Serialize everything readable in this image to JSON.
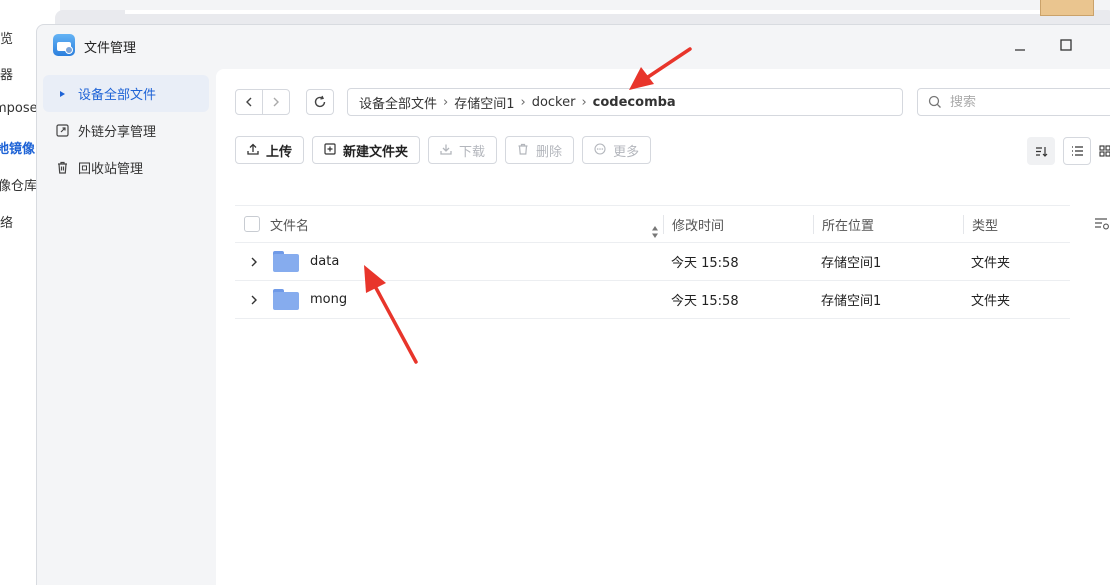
{
  "background_app": {
    "items": [
      {
        "label": "览"
      },
      {
        "label": "器"
      },
      {
        "label": "mpose"
      },
      {
        "label": "地镜像"
      },
      {
        "label": "像仓库"
      },
      {
        "label": "络"
      }
    ],
    "close_glyph": "x"
  },
  "window": {
    "title": "文件管理",
    "app_icon": "file-manager-app-icon",
    "controls": {
      "minimize": "—",
      "maximize": "☐",
      "close": "×"
    }
  },
  "sidebar": {
    "items": [
      {
        "label": "设备全部文件",
        "icon": "caret-right-icon",
        "active": true
      },
      {
        "label": "外链分享管理",
        "icon": "link-icon",
        "active": false
      },
      {
        "label": "回收站管理",
        "icon": "trash-icon",
        "active": false
      }
    ]
  },
  "breadcrumb": {
    "parts": [
      "设备全部文件",
      "存储空间1",
      "docker"
    ],
    "current": "codecomba"
  },
  "search": {
    "placeholder": "搜索"
  },
  "toolbar": {
    "upload": "上传",
    "new_folder": "新建文件夹",
    "download": "下载",
    "delete": "删除",
    "more": "更多"
  },
  "table": {
    "headers": {
      "name": "文件名",
      "modified": "修改时间",
      "location": "所在位置",
      "type": "类型"
    },
    "rows": [
      {
        "name": "data",
        "modified": "今天 15:58",
        "location": "存储空间1",
        "type": "文件夹"
      },
      {
        "name": "mong",
        "modified": "今天 15:58",
        "location": "存储空间1",
        "type": "文件夹"
      }
    ]
  },
  "colors": {
    "accent": "#1e63d6",
    "folder": "#86acee",
    "annotation_arrow": "#e8352b"
  }
}
